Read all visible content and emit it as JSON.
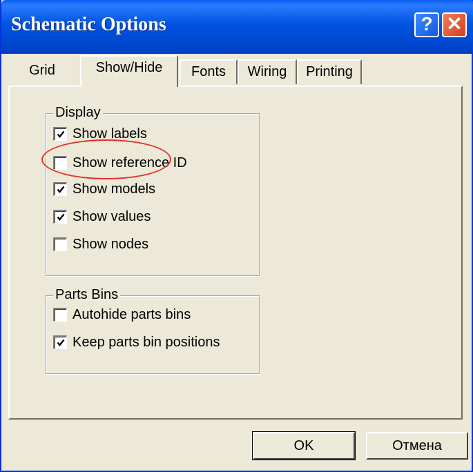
{
  "window": {
    "title": "Schematic Options",
    "help_glyph": "?",
    "close_glyph": "✕"
  },
  "tabs": [
    {
      "label": "Grid",
      "active": false
    },
    {
      "label": "Show/Hide",
      "active": true
    },
    {
      "label": "Fonts",
      "active": false
    },
    {
      "label": "Wiring",
      "active": false
    },
    {
      "label": "Printing",
      "active": false
    }
  ],
  "display": {
    "legend": "Display",
    "options": [
      {
        "label": "Show labels",
        "checked": true
      },
      {
        "label": "Show reference ID",
        "checked": false
      },
      {
        "label": "Show models",
        "checked": true
      },
      {
        "label": "Show values",
        "checked": true
      },
      {
        "label": "Show nodes",
        "checked": false
      }
    ]
  },
  "parts_bins": {
    "legend": "Parts Bins",
    "options": [
      {
        "label": "Autohide parts bins",
        "checked": false
      },
      {
        "label": "Keep parts bin positions",
        "checked": true
      }
    ]
  },
  "buttons": {
    "ok": "OK",
    "cancel": "Отмена"
  },
  "colors": {
    "titlebar": "#0053e1",
    "dialog_bg": "#ece9d8",
    "highlight_circle": "#e3312a"
  },
  "icons": {
    "help": "help-question-icon",
    "close": "close-x-icon",
    "check": "checkmark-icon"
  }
}
